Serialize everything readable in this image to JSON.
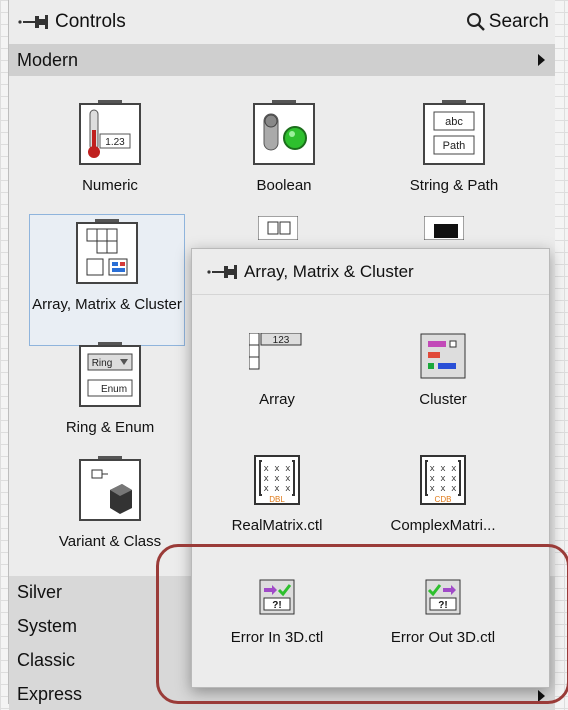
{
  "palette": {
    "title": "Controls",
    "search_label": "Search",
    "modern_category": "Modern",
    "items": [
      {
        "label": "Numeric"
      },
      {
        "label": "Boolean"
      },
      {
        "label": "String & Path"
      },
      {
        "label": "Array, Matrix & Cluster"
      },
      {
        "label": "Ring & Enum"
      },
      {
        "label": "Variant & Class"
      }
    ],
    "numeric_icon_text": "1.23",
    "string_icon_text_1": "abc",
    "string_icon_text_2": "Path",
    "ring_icon_text": "Ring",
    "enum_icon_text": "Enum",
    "lower_categories": [
      "Silver",
      "System",
      "Classic",
      "Express"
    ]
  },
  "popup": {
    "title": "Array, Matrix & Cluster",
    "items": [
      {
        "label": "Array"
      },
      {
        "label": "Cluster"
      },
      {
        "label": "RealMatrix.ctl"
      },
      {
        "label": "ComplexMatri..."
      },
      {
        "label": "Error In 3D.ctl"
      },
      {
        "label": "Error Out 3D.ctl"
      }
    ],
    "matrix_real_tag": "DBL",
    "matrix_complex_tag": "CDB",
    "array_icon_text": "123",
    "error_icon_text": "?!"
  },
  "colors": {
    "highlight": "#9a3b38",
    "selection_border": "#8fb4dc",
    "boolean_led": "#2ec02e",
    "tag_orange": "#e07a18"
  }
}
